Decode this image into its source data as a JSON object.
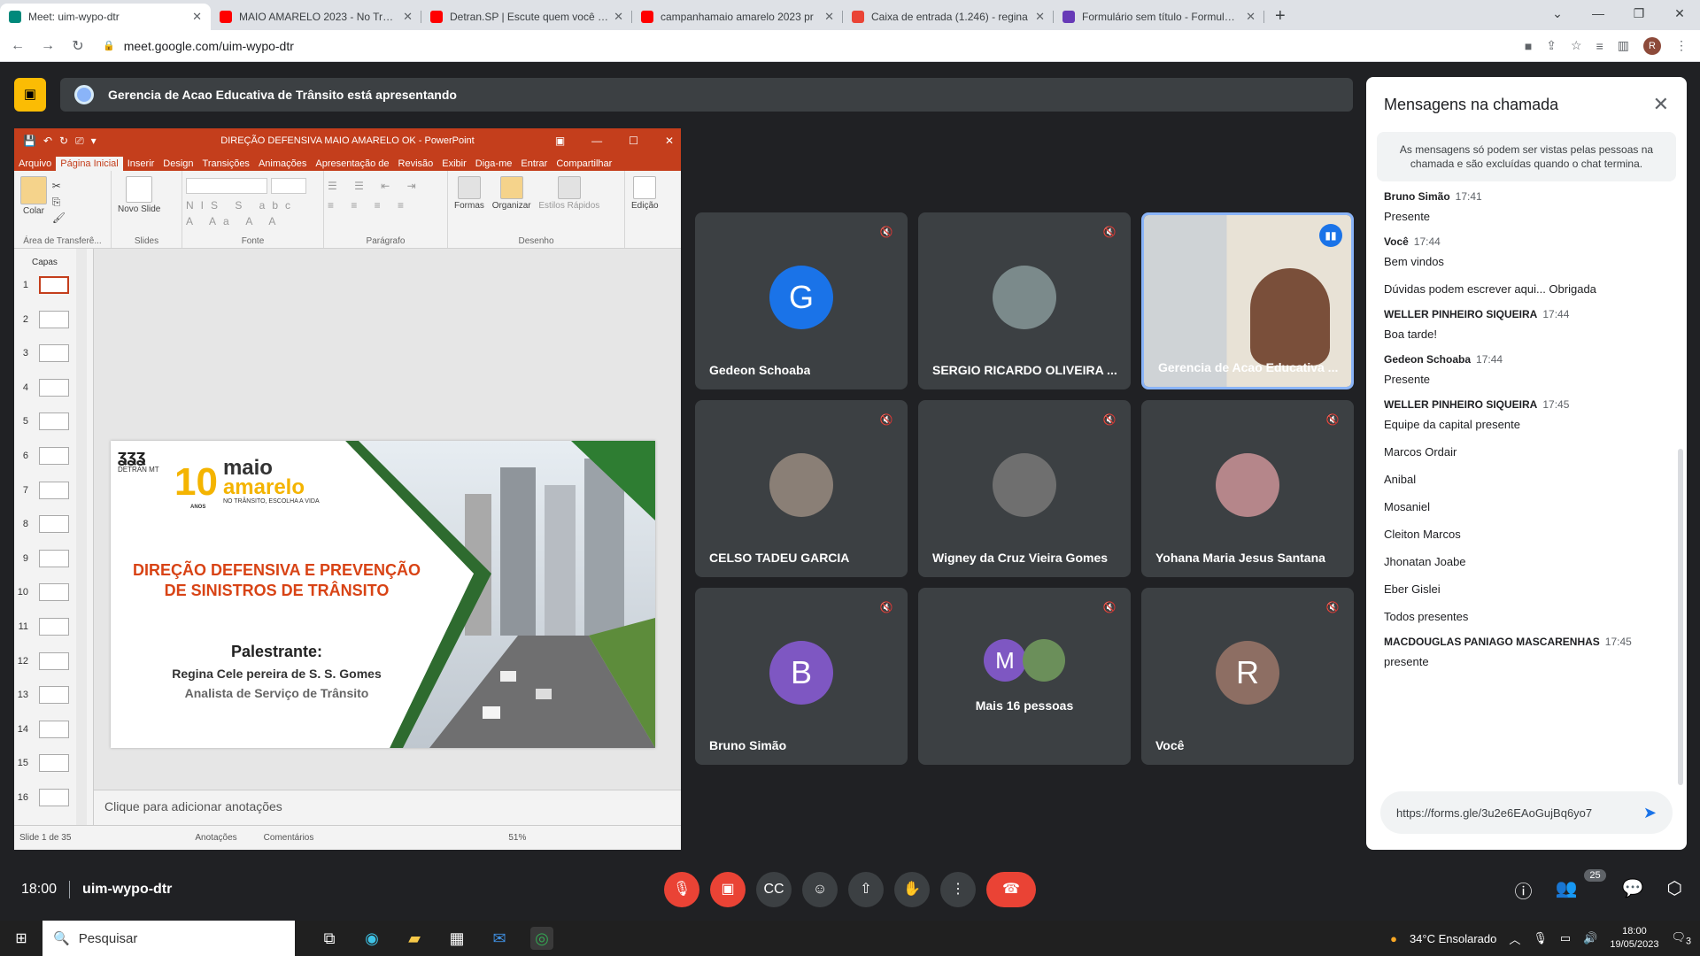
{
  "browser": {
    "tabs": [
      {
        "title": "Meet: uim-wypo-dtr",
        "color": "#00897b",
        "active": true
      },
      {
        "title": "MAIO AMARELO 2023 - No Trânsito",
        "color": "#ff0000",
        "active": false
      },
      {
        "title": "Detran.SP | Escute quem você ama",
        "color": "#ff0000",
        "active": false
      },
      {
        "title": "campanhamaio amarelo 2023 pr",
        "color": "#ff0000",
        "active": false
      },
      {
        "title": "Caixa de entrada (1.246) - regina",
        "color": "#ea4335",
        "active": false
      },
      {
        "title": "Formulário sem título - Formulários",
        "color": "#673ab7",
        "active": false
      }
    ],
    "url": "meet.google.com/uim-wypo-dtr",
    "profile_initial": "R"
  },
  "meet": {
    "presenting_label": "Gerencia de Acao Educativa de Trânsito está apresentando",
    "meeting_code": "uim-wypo-dtr",
    "time": "18:00",
    "participants_count": "25",
    "tiles": [
      {
        "name": "Gedeon Schoaba",
        "initial": "G",
        "color": "#1a73e8"
      },
      {
        "name": "SERGIO RICARDO OLIVEIRA ...",
        "initial": "",
        "color": "#7b8a8b"
      },
      {
        "name": "Gerencia de Acao Educativa ...",
        "initial": "",
        "color": "#9c8b7a"
      },
      {
        "name": "CELSO TADEU GARCIA",
        "initial": "",
        "color": "#8a7f76"
      },
      {
        "name": "Wigney da Cruz Vieira Gomes",
        "initial": "",
        "color": "#6f6f6f"
      },
      {
        "name": "Yohana Maria Jesus Santana",
        "initial": "",
        "color": "#b5868a"
      },
      {
        "name": "Bruno Simão",
        "initial": "B",
        "color": "#7e57c2"
      },
      {
        "name": "Mais 16 pessoas",
        "initial": "M",
        "color": "#7e57c2"
      },
      {
        "name": "Você",
        "initial": "R",
        "color": "#8d6e63"
      }
    ]
  },
  "ppt": {
    "title": "DIREÇÃO DEFENSIVA MAIO AMARELO OK - PowerPoint",
    "menu": [
      "Arquivo",
      "Página Inicial",
      "Inserir",
      "Design",
      "Transições",
      "Animações",
      "Apresentação de",
      "Revisão",
      "Exibir",
      "Diga-me",
      "Entrar",
      "Compartilhar"
    ],
    "groups": [
      "Área de Transferê...",
      "Slides",
      "Fonte",
      "Parágrafo",
      "Desenho"
    ],
    "buttons": {
      "paste": "Colar",
      "new_slide": "Novo Slide",
      "shapes": "Formas",
      "arrange": "Organizar",
      "quick_styles": "Estilos Rápidos",
      "editing": "Edição"
    },
    "thumbs_header": "Capas",
    "thumb_numbers": [
      "1",
      "2",
      "3",
      "4",
      "5",
      "6",
      "7",
      "8",
      "9",
      "10",
      "11",
      "12",
      "13",
      "14",
      "15",
      "16"
    ],
    "notes_placeholder": "Clique para adicionar anotações",
    "status": "Slide 1 de 35",
    "status_notes": "Anotações",
    "status_comments": "Comentários",
    "zoom": "51%",
    "slide": {
      "logo_org": "DETRAN MT",
      "logo_num": "10",
      "logo_anos": "ANOS",
      "brand_1": "maio",
      "brand_2": "amarelo",
      "brand_tag": "NO TRÂNSITO, ESCOLHA A VIDA",
      "headline_1": "DIREÇÃO DEFENSIVA E PREVENÇÃO",
      "headline_2": "DE SINISTROS DE TRÂNSITO",
      "speaker_label": "Palestrante:",
      "speaker_name": "Regina Cele pereira de S. S. Gomes",
      "speaker_role": "Analista de Serviço de Trânsito"
    }
  },
  "chat": {
    "title": "Mensagens na chamada",
    "notice": "As mensagens só podem ser vistas pelas pessoas na chamada e são excluídas quando o chat termina.",
    "messages": [
      {
        "who": "Bruno Simão",
        "time": "17:41",
        "lines": [
          "Presente"
        ]
      },
      {
        "who": "Você",
        "time": "17:44",
        "lines": [
          "Bem vindos",
          "Dúvidas podem escrever aqui... Obrigada"
        ]
      },
      {
        "who": "WELLER PINHEIRO SIQUEIRA",
        "time": "17:44",
        "lines": [
          "Boa tarde!"
        ]
      },
      {
        "who": "Gedeon Schoaba",
        "time": "17:44",
        "lines": [
          "Presente"
        ]
      },
      {
        "who": "WELLER PINHEIRO SIQUEIRA",
        "time": "17:45",
        "lines": [
          "Equipe da capital presente",
          "Marcos Ordair",
          "Anibal",
          "Mosaniel",
          "Cleiton Marcos",
          "Jhonatan Joabe",
          "Eber Gislei",
          "Todos presentes"
        ]
      },
      {
        "who": "MACDOUGLAS PANIAGO MASCARENHAS",
        "time": "17:45",
        "lines": [
          "presente"
        ]
      }
    ],
    "input_value": "https://forms.gle/3u2e6EAoGujBq6yo7"
  },
  "taskbar": {
    "search": "Pesquisar",
    "weather": "34°C  Ensolarado",
    "time": "18:00",
    "date": "19/05/2023",
    "notif": "3"
  }
}
